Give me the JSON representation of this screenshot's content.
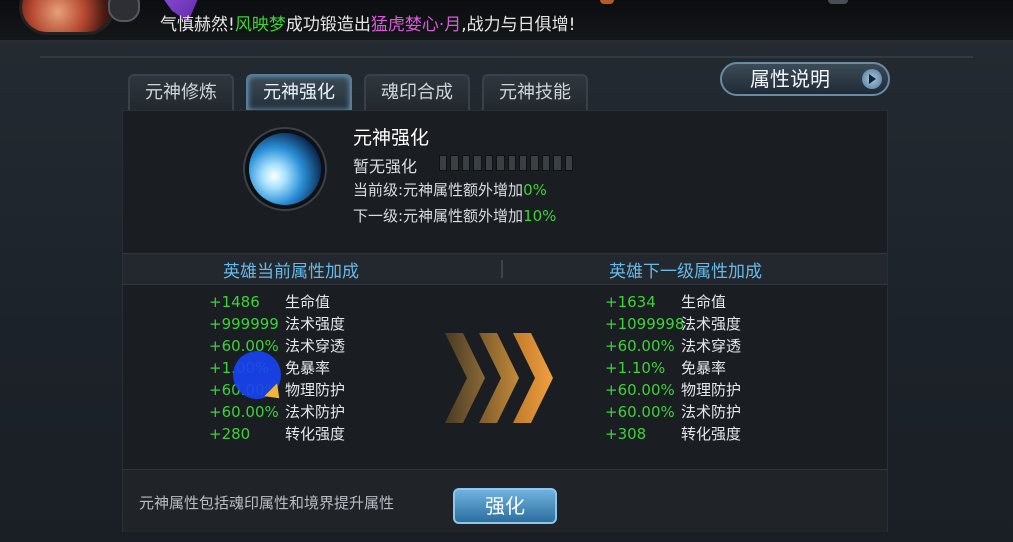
{
  "ticker": {
    "prefix": "气慎赫然!",
    "player": "风映梦",
    "mid": "成功锻造出",
    "item": "猛虎婪心·月",
    "suffix": ",战力与日俱增!"
  },
  "tabs": [
    {
      "label": "元神修炼",
      "active": false
    },
    {
      "label": "元神强化",
      "active": true
    },
    {
      "label": "魂印合成",
      "active": false
    },
    {
      "label": "元神技能",
      "active": false
    }
  ],
  "help_button": "属性说明",
  "enhance": {
    "title": "元神强化",
    "status": "暂无强化",
    "segments_total": 12,
    "segments_filled": 0,
    "current_prefix": "当前级:元神属性额外增加",
    "current_value": "0%",
    "next_prefix": "下一级:元神属性额外增加",
    "next_value": "10%"
  },
  "current_header": "英雄当前属性加成",
  "next_header": "英雄下一级属性加成",
  "current_stats": [
    {
      "value": "+1486",
      "name": "生命值"
    },
    {
      "value": "+999999",
      "name": "法术强度"
    },
    {
      "value": "+60.00%",
      "name": "法术穿透"
    },
    {
      "value": "+1.00%",
      "name": "免暴率"
    },
    {
      "value": "+60.00%",
      "name": "物理防护"
    },
    {
      "value": "+60.00%",
      "name": "法术防护"
    },
    {
      "value": "+280",
      "name": "转化强度"
    }
  ],
  "next_stats": [
    {
      "value": "+1634",
      "name": "生命值"
    },
    {
      "value": "+1099998",
      "name": "法术强度"
    },
    {
      "value": "+60.00%",
      "name": "法术穿透"
    },
    {
      "value": "+1.10%",
      "name": "免暴率"
    },
    {
      "value": "+60.00%",
      "name": "物理防护"
    },
    {
      "value": "+60.00%",
      "name": "法术防护"
    },
    {
      "value": "+308",
      "name": "转化强度"
    }
  ],
  "footer_note": "元神属性包括魂印属性和境界提升属性",
  "enhance_button": "强化",
  "colors": {
    "green": "#3ed13a",
    "purple": "#d85cd6",
    "header_blue": "#67b9e8"
  }
}
